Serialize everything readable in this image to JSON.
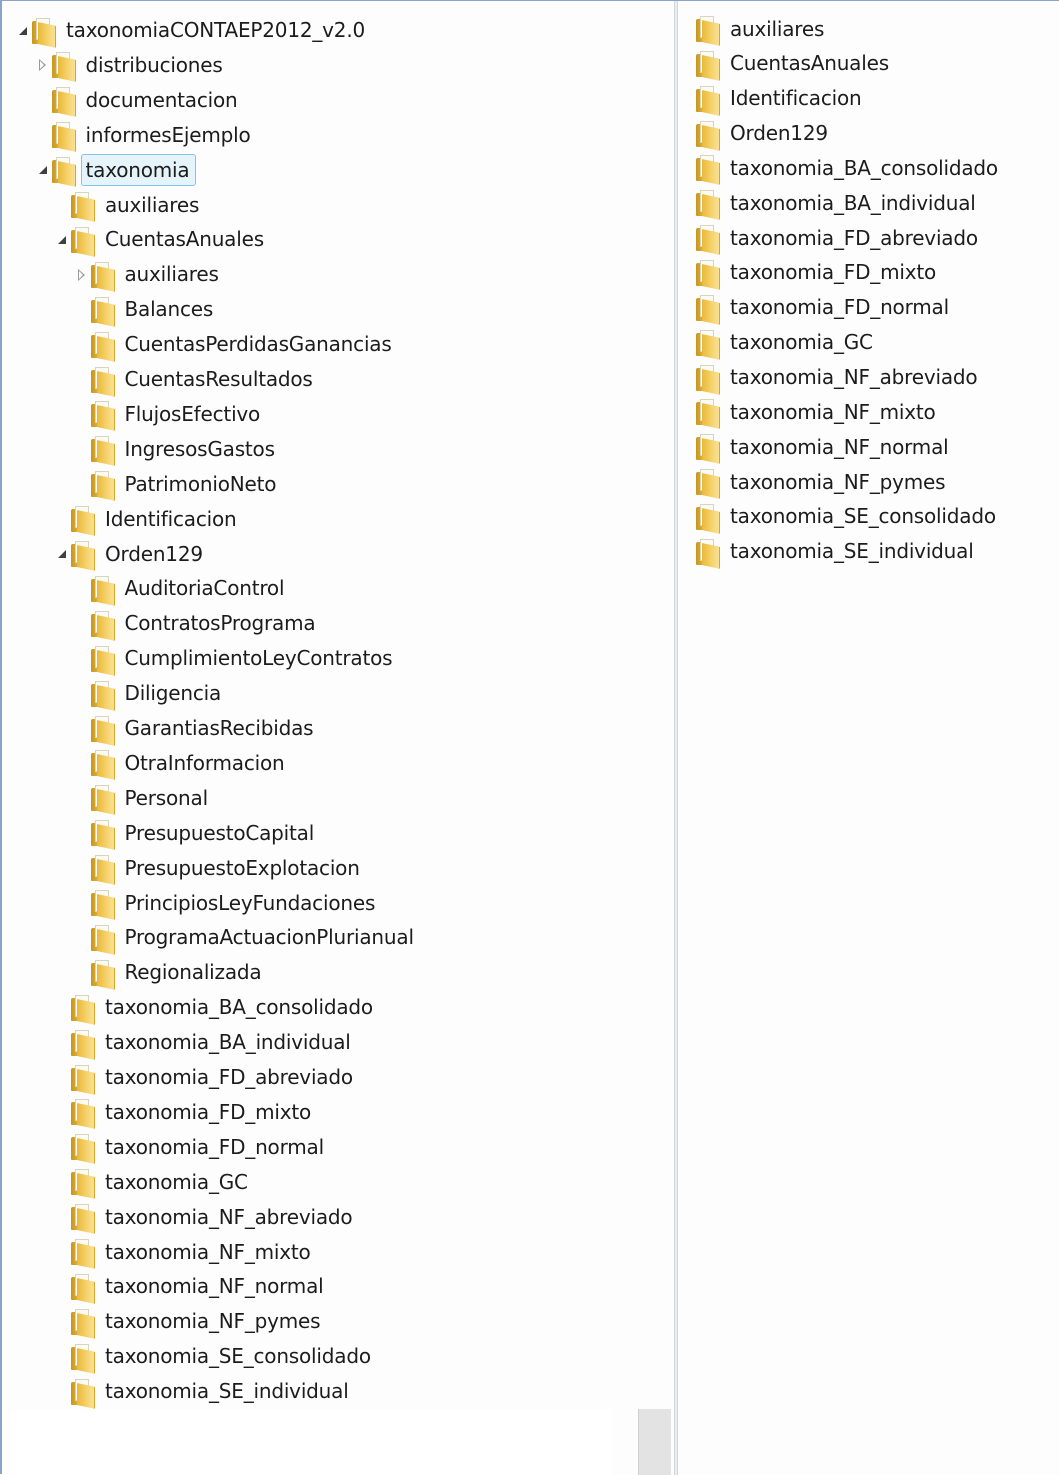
{
  "tree": {
    "items": [
      {
        "label": "taxonomiaCONTAEP2012_v2.0",
        "level": 0,
        "expander": "open"
      },
      {
        "label": "distribuciones",
        "level": 1,
        "expander": "closed"
      },
      {
        "label": "documentacion",
        "level": 1,
        "expander": "none"
      },
      {
        "label": "informesEjemplo",
        "level": 1,
        "expander": "none"
      },
      {
        "label": "taxonomia",
        "level": 1,
        "expander": "open",
        "selected": true
      },
      {
        "label": "auxiliares",
        "level": 2,
        "expander": "none"
      },
      {
        "label": "CuentasAnuales",
        "level": 2,
        "expander": "open"
      },
      {
        "label": "auxiliares",
        "level": 3,
        "expander": "closed"
      },
      {
        "label": "Balances",
        "level": 3,
        "expander": "none"
      },
      {
        "label": "CuentasPerdidasGanancias",
        "level": 3,
        "expander": "none"
      },
      {
        "label": "CuentasResultados",
        "level": 3,
        "expander": "none"
      },
      {
        "label": "FlujosEfectivo",
        "level": 3,
        "expander": "none"
      },
      {
        "label": "IngresosGastos",
        "level": 3,
        "expander": "none"
      },
      {
        "label": "PatrimonioNeto",
        "level": 3,
        "expander": "none"
      },
      {
        "label": "Identificacion",
        "level": 2,
        "expander": "none"
      },
      {
        "label": "Orden129",
        "level": 2,
        "expander": "open"
      },
      {
        "label": "AuditoriaControl",
        "level": 3,
        "expander": "none"
      },
      {
        "label": "ContratosPrograma",
        "level": 3,
        "expander": "none"
      },
      {
        "label": "CumplimientoLeyContratos",
        "level": 3,
        "expander": "none"
      },
      {
        "label": "Diligencia",
        "level": 3,
        "expander": "none"
      },
      {
        "label": "GarantiasRecibidas",
        "level": 3,
        "expander": "none"
      },
      {
        "label": "OtraInformacion",
        "level": 3,
        "expander": "none"
      },
      {
        "label": "Personal",
        "level": 3,
        "expander": "none"
      },
      {
        "label": "PresupuestoCapital",
        "level": 3,
        "expander": "none"
      },
      {
        "label": "PresupuestoExplotacion",
        "level": 3,
        "expander": "none"
      },
      {
        "label": "PrincipiosLeyFundaciones",
        "level": 3,
        "expander": "none"
      },
      {
        "label": "ProgramaActuacionPlurianual",
        "level": 3,
        "expander": "none"
      },
      {
        "label": "Regionalizada",
        "level": 3,
        "expander": "none"
      },
      {
        "label": "taxonomia_BA_consolidado",
        "level": 2,
        "expander": "none"
      },
      {
        "label": "taxonomia_BA_individual",
        "level": 2,
        "expander": "none"
      },
      {
        "label": "taxonomia_FD_abreviado",
        "level": 2,
        "expander": "none"
      },
      {
        "label": "taxonomia_FD_mixto",
        "level": 2,
        "expander": "none"
      },
      {
        "label": "taxonomia_FD_normal",
        "level": 2,
        "expander": "none"
      },
      {
        "label": "taxonomia_GC",
        "level": 2,
        "expander": "none"
      },
      {
        "label": "taxonomia_NF_abreviado",
        "level": 2,
        "expander": "none"
      },
      {
        "label": "taxonomia_NF_mixto",
        "level": 2,
        "expander": "none"
      },
      {
        "label": "taxonomia_NF_normal",
        "level": 2,
        "expander": "none"
      },
      {
        "label": "taxonomia_NF_pymes",
        "level": 2,
        "expander": "none"
      },
      {
        "label": "taxonomia_SE_consolidado",
        "level": 2,
        "expander": "none"
      },
      {
        "label": "taxonomia_SE_individual",
        "level": 2,
        "expander": "none"
      }
    ]
  },
  "content_list": {
    "items": [
      {
        "label": "auxiliares"
      },
      {
        "label": "CuentasAnuales"
      },
      {
        "label": "Identificacion"
      },
      {
        "label": "Orden129"
      },
      {
        "label": "taxonomia_BA_consolidado"
      },
      {
        "label": "taxonomia_BA_individual"
      },
      {
        "label": "taxonomia_FD_abreviado"
      },
      {
        "label": "taxonomia_FD_mixto"
      },
      {
        "label": "taxonomia_FD_normal"
      },
      {
        "label": "taxonomia_GC"
      },
      {
        "label": "taxonomia_NF_abreviado"
      },
      {
        "label": "taxonomia_NF_mixto"
      },
      {
        "label": "taxonomia_NF_normal"
      },
      {
        "label": "taxonomia_NF_pymes"
      },
      {
        "label": "taxonomia_SE_consolidado"
      },
      {
        "label": "taxonomia_SE_individual"
      }
    ]
  }
}
